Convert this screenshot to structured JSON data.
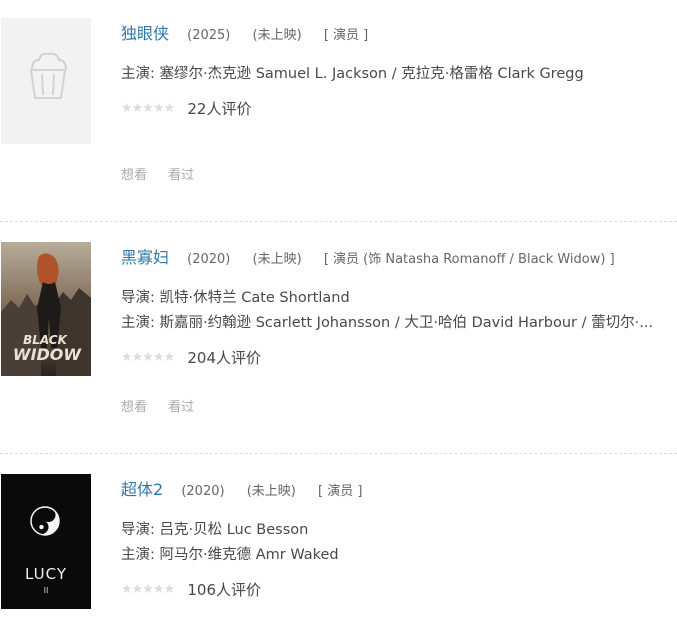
{
  "items": [
    {
      "title": "独眼侠",
      "year": "(2025)",
      "status": "(未上映)",
      "role": "[ 演员 ]",
      "credits": [
        "主演: 塞缪尔·杰克逊 Samuel L. Jackson / 克拉克·格雷格 Clark Gregg"
      ],
      "rating_count": "22人评价",
      "actions": [
        "想看",
        "看过"
      ]
    },
    {
      "title": "黑寡妇",
      "year": "(2020)",
      "status": "(未上映)",
      "role": "[ 演员 (饰 Natasha Romanoff / Black Widow) ]",
      "credits": [
        "导演: 凯特·休特兰 Cate Shortland",
        "主演: 斯嘉丽·约翰逊 Scarlett Johansson / 大卫·哈伯 David Harbour / 蕾切尔·..."
      ],
      "rating_count": "204人评价",
      "actions": [
        "想看",
        "看过"
      ],
      "poster_text": [
        "BLACK",
        "WIDOW"
      ]
    },
    {
      "title": "超体2",
      "year": "(2020)",
      "status": "(未上映)",
      "role": "[ 演员 ]",
      "credits": [
        "导演: 吕克·贝松 Luc Besson",
        "主演: 阿马尔·维克德 Amr Waked"
      ],
      "rating_count": "106人评价",
      "poster_text": [
        "LUCY",
        "II"
      ]
    }
  ],
  "icons": {
    "placeholder": "popcorn-icon",
    "yin_yang": "yin-yang-icon",
    "stars": "star-rating-icon"
  },
  "stars_glyph": "★★★★★",
  "colors": {
    "title_link": "#3377aa",
    "text": "#494949",
    "muted": "#aaaaaa",
    "stars_empty": "#dddddd"
  }
}
